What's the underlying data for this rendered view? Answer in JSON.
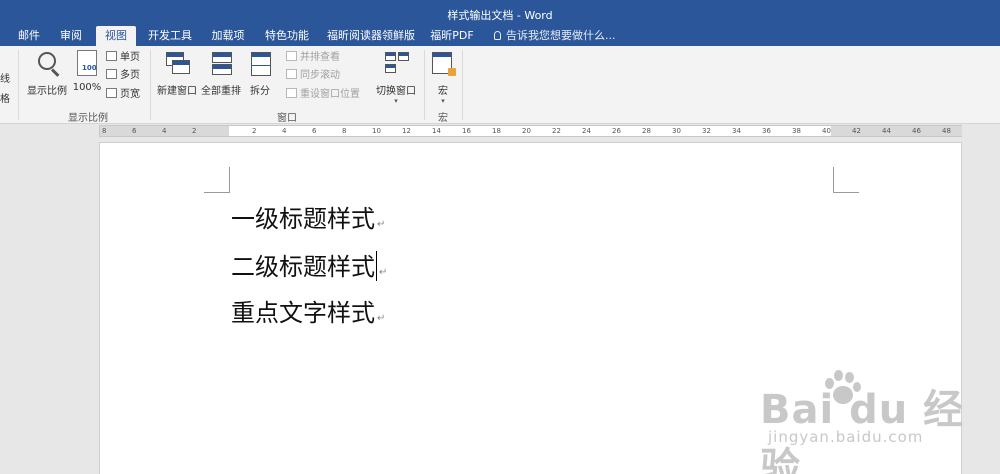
{
  "window": {
    "title": "样式输出文档 - Word"
  },
  "tabs": [
    {
      "label": "邮件"
    },
    {
      "label": "审阅"
    },
    {
      "label": "视图",
      "active": true
    },
    {
      "label": "开发工具"
    },
    {
      "label": "加载项"
    },
    {
      "label": "特色功能"
    },
    {
      "label": "福昕阅读器领鲜版"
    },
    {
      "label": "福昕PDF"
    }
  ],
  "tell_me": {
    "placeholder": "告诉我您想要做什么..."
  },
  "ribbon": {
    "left_cut": [
      "线",
      "格"
    ],
    "zoom_group": {
      "label": "显示比例",
      "zoom_button": "显示比例",
      "hundred_button": "100%",
      "one_page": "单页",
      "multi_page": "多页",
      "page_width": "页宽"
    },
    "window_group": {
      "label": "窗口",
      "new_window": "新建窗口",
      "arrange_all": "全部重排",
      "split": "拆分",
      "side_by_side": "并排查看",
      "sync_scroll": "同步滚动",
      "reset_position": "重设窗口位置",
      "switch_window": "切换窗口"
    },
    "macro_group": {
      "label": "宏",
      "macro_button": "宏"
    }
  },
  "ruler": {
    "ticks": [
      "8",
      "6",
      "4",
      "2",
      "",
      "2",
      "4",
      "6",
      "8",
      "10",
      "12",
      "14",
      "16",
      "18",
      "20",
      "22",
      "24",
      "26",
      "28",
      "30",
      "32",
      "34",
      "36",
      "38",
      "40",
      "42",
      "44",
      "46",
      "48"
    ]
  },
  "document": {
    "paragraphs": [
      {
        "text": "一级标题样式"
      },
      {
        "text": "二级标题样式",
        "cursor": true
      },
      {
        "text": "重点文字样式"
      }
    ],
    "paragraph_mark": "↵"
  },
  "watermark": {
    "logo": "Bai du 经验",
    "url": "jingyan.baidu.com"
  }
}
